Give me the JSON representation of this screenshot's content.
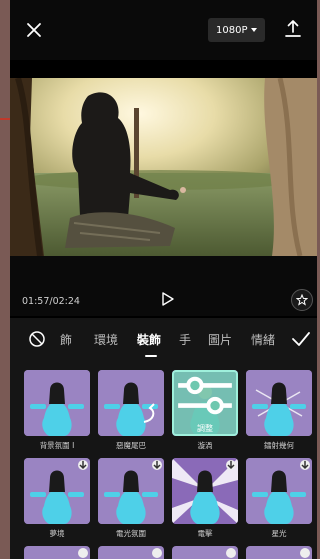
{
  "topbar": {
    "resolution_label": "1080P",
    "icons": {
      "close": "close-icon",
      "caret": "chevron-down-icon",
      "export": "export-upload-icon"
    }
  },
  "player": {
    "time_label": "01:57/02:24",
    "icons": {
      "play": "play-icon",
      "favorite": "star-icon"
    }
  },
  "tabs": {
    "items": [
      {
        "label": "飾"
      },
      {
        "label": "環境"
      },
      {
        "label": "裝飾",
        "active": true
      },
      {
        "label": "手"
      },
      {
        "label": "圖片"
      },
      {
        "label": "情緒"
      }
    ],
    "icons": {
      "none": "no-effect-icon",
      "confirm": "checkmark-icon"
    }
  },
  "effects": {
    "row1": [
      {
        "label": "背景氛圍 I"
      },
      {
        "label": "惡魔尾巴"
      },
      {
        "label": "漩渦",
        "selected": true,
        "overlay_label": "調整"
      },
      {
        "label": "鐳射幾何"
      }
    ],
    "row2": [
      {
        "label": "夢境",
        "download": true
      },
      {
        "label": "電光氛圍",
        "download": true
      },
      {
        "label": "電擊",
        "download": true
      },
      {
        "label": "星光",
        "download": true
      }
    ]
  },
  "colors": {
    "accent_selected": "#6ec8af",
    "thumb_bg": "#9a84c2",
    "panel_bg": "#151515"
  }
}
